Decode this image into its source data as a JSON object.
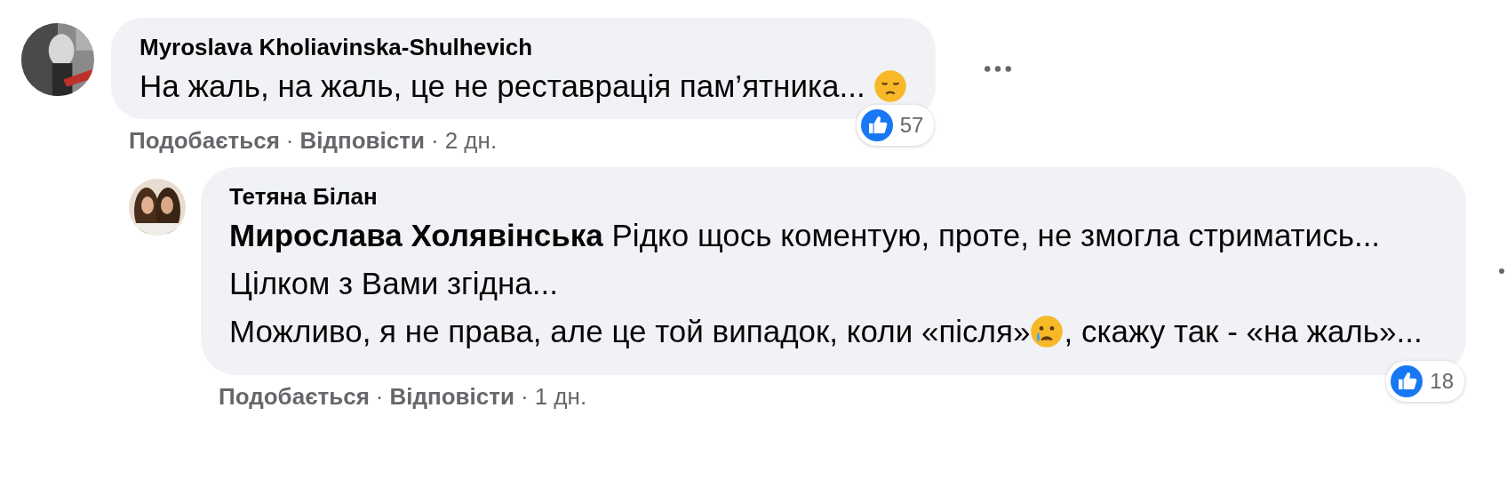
{
  "comments": [
    {
      "author": "Myroslava Kholiavinska-Shulhevich",
      "paragraphs": [
        [
          {
            "kind": "text",
            "text": "На жаль, на жаль, це не реставрація пам’ятника... "
          },
          {
            "kind": "sad-emoji"
          }
        ]
      ],
      "reactions": "57",
      "separator": "·",
      "actions": [
        {
          "kind": "link",
          "text": "Подобається"
        },
        {
          "kind": "link",
          "text": "Відповісти"
        },
        {
          "kind": "time",
          "text": "2 дн."
        }
      ],
      "replies": [
        {
          "author": "Тетяна Білан",
          "paragraphs": [
            [
              {
                "kind": "text",
                "text": "**Мирослава Холявінська** Рідко щось коментую, проте, не змогла стриматись... Цілком з Вами згідна..."
              }
            ],
            [
              {
                "kind": "text",
                "text": "Можливо, я не права, але це той випадок, коли «після»"
              },
              {
                "kind": "crying-emoji"
              },
              {
                "kind": "text",
                "text": ", скажу так - «на жаль»..."
              }
            ]
          ],
          "reactions": "18",
          "separator": "·",
          "actions": [
            {
              "kind": "link",
              "text": "Подобається"
            },
            {
              "kind": "link",
              "text": "Відповісти"
            },
            {
              "kind": "time",
              "text": "1 дн."
            }
          ]
        }
      ]
    }
  ]
}
